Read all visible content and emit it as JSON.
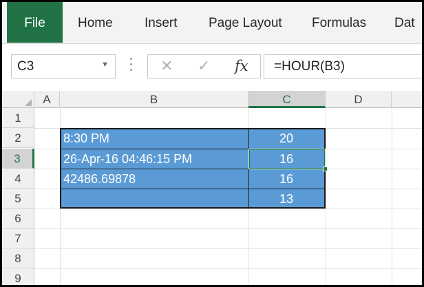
{
  "ribbon": {
    "tabs": [
      {
        "label": "File",
        "active": true
      },
      {
        "label": "Home"
      },
      {
        "label": "Insert"
      },
      {
        "label": "Page Layout"
      },
      {
        "label": "Formulas"
      },
      {
        "label": "Dat"
      }
    ]
  },
  "formula_bar": {
    "name_box": "C3",
    "cancel_icon": "✕",
    "enter_icon": "✓",
    "fx_label": "fx",
    "formula": "=HOUR(B3)"
  },
  "columns": [
    "A",
    "B",
    "C",
    "D"
  ],
  "active_column": "C",
  "rows": [
    "1",
    "2",
    "3",
    "4",
    "5",
    "6",
    "7",
    "8",
    "9"
  ],
  "active_row": "3",
  "cells": {
    "B2": "8:30 PM",
    "B3": "26-Apr-16 04:46:15 PM",
    "B4": "42486.69878",
    "B5": "",
    "C2": "20",
    "C3": "16",
    "C4": "16",
    "C5": "13"
  },
  "colors": {
    "excel_green": "#217346",
    "data_fill": "#5b9bd5",
    "data_text": "#ffffff"
  }
}
